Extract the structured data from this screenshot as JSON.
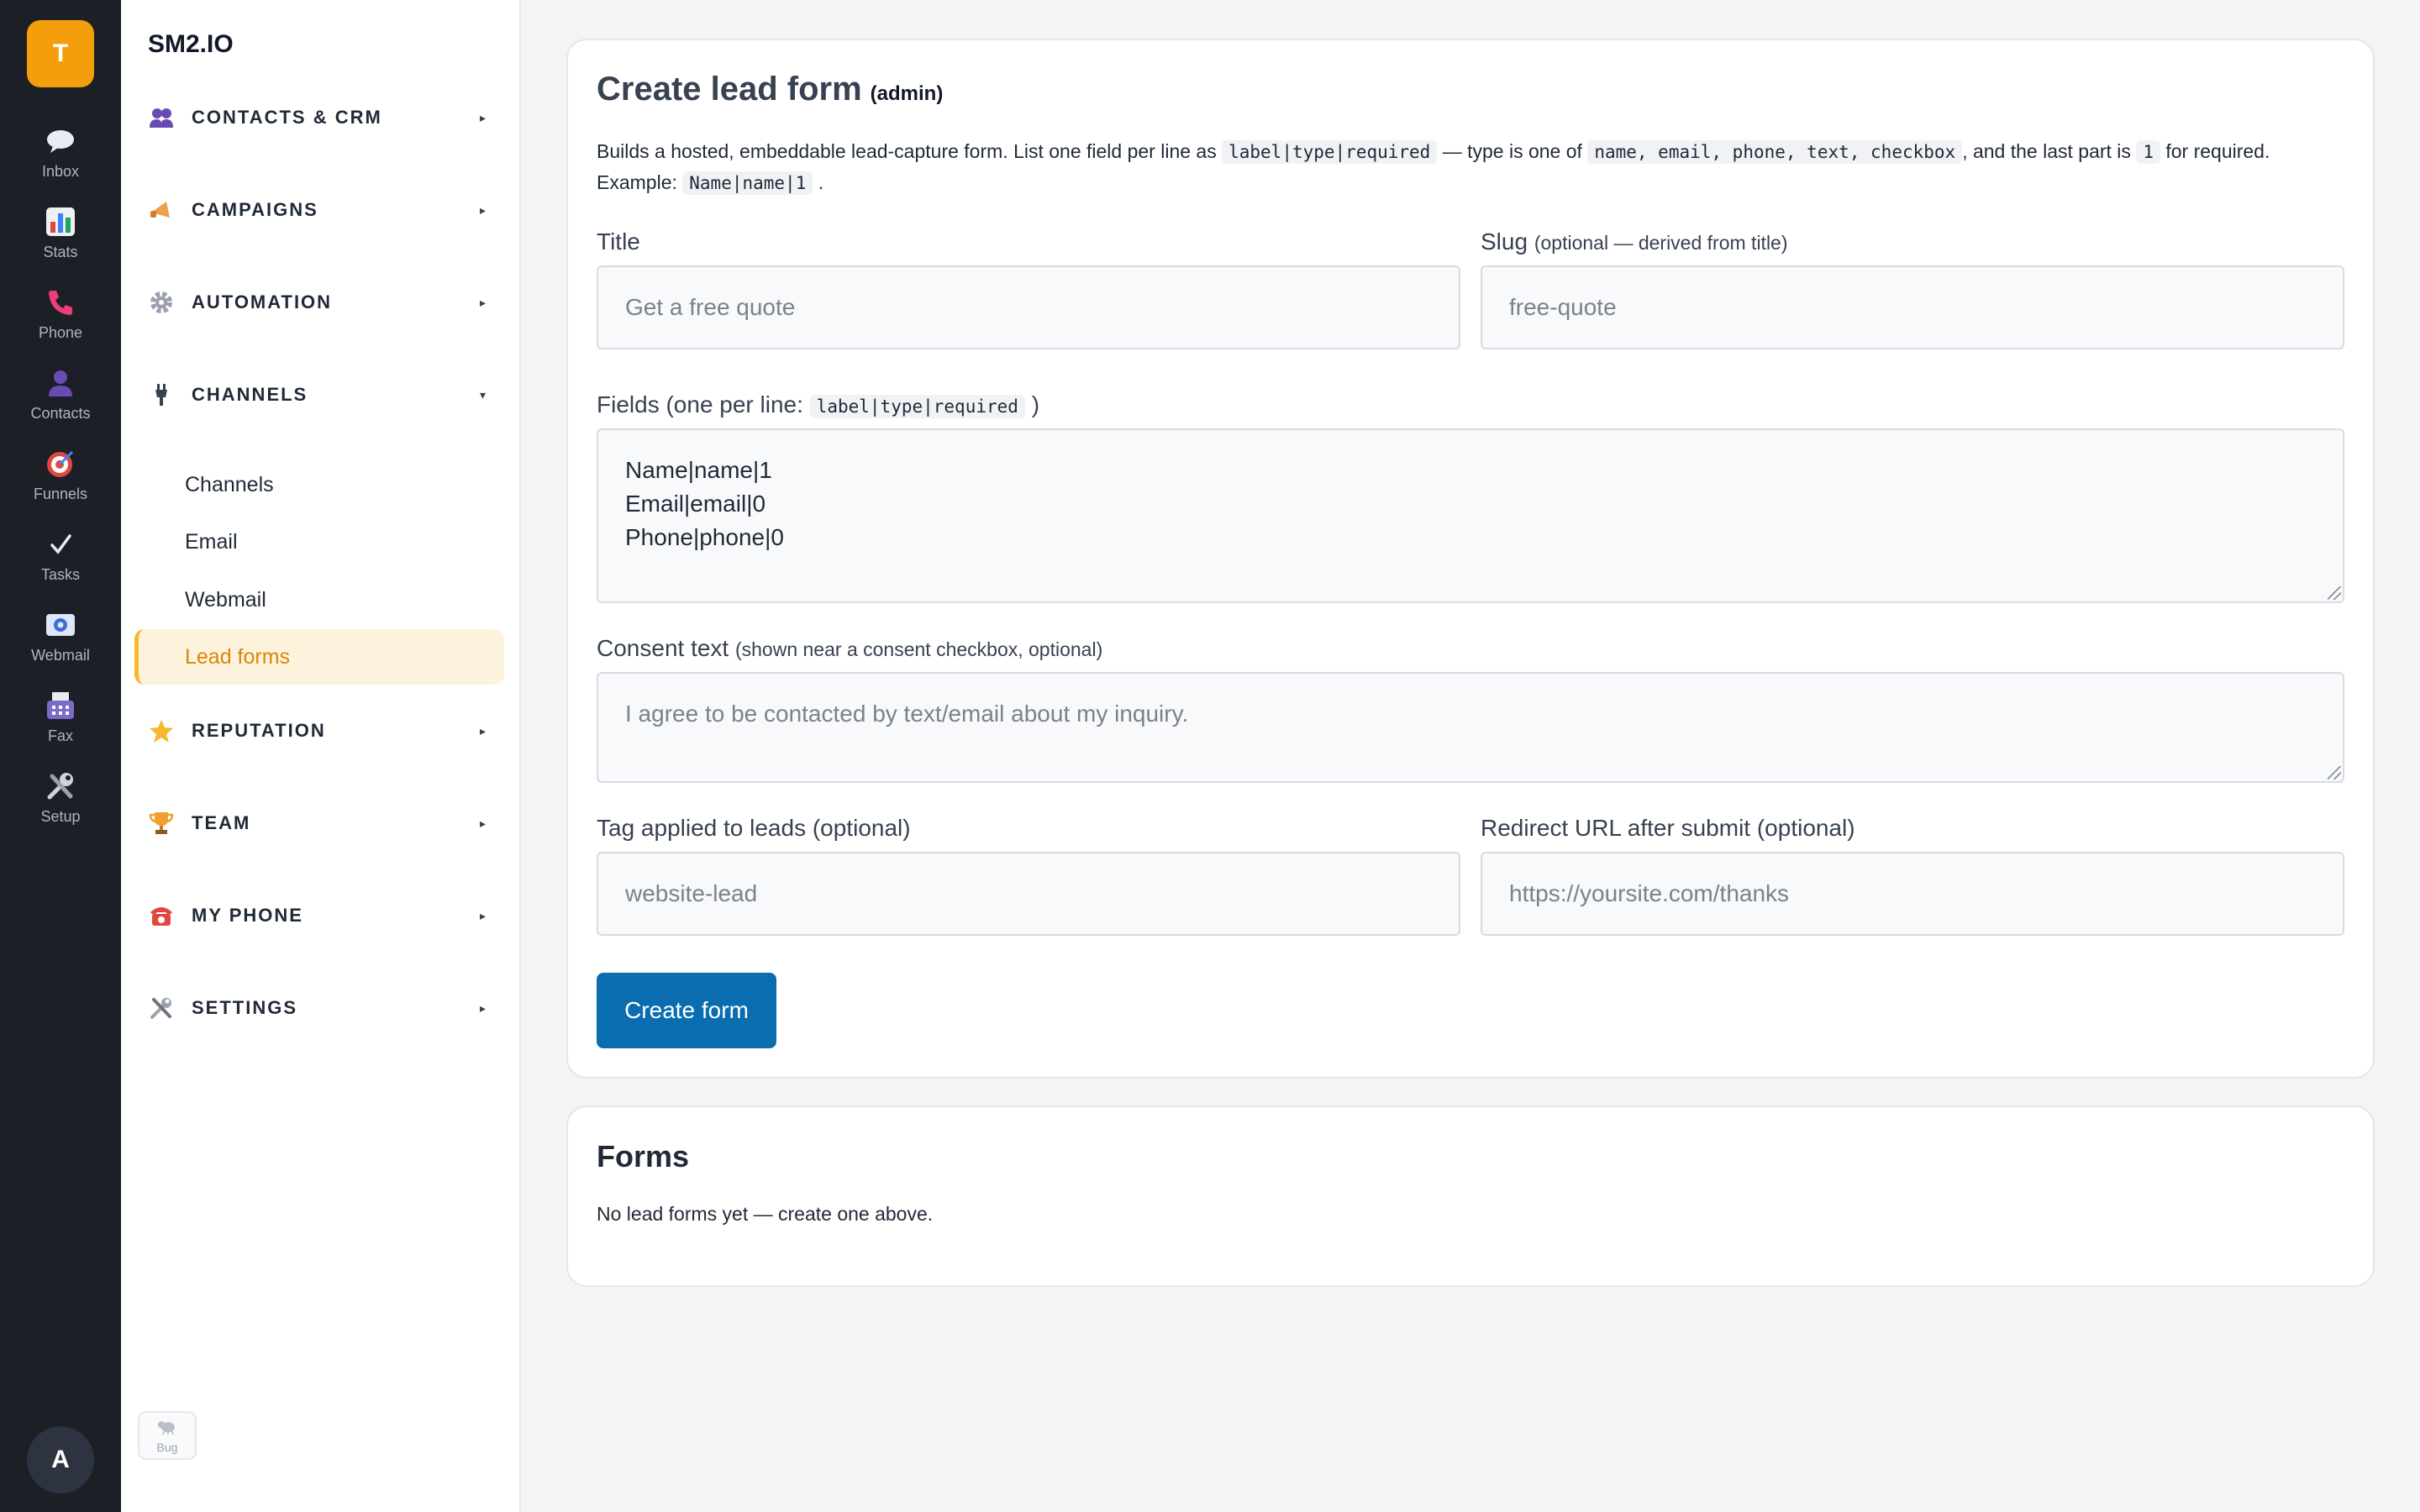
{
  "rail": {
    "brand_initial": "T",
    "items": [
      {
        "label": "Inbox",
        "icon": "chat-bubble-icon"
      },
      {
        "label": "Stats",
        "icon": "bar-chart-icon"
      },
      {
        "label": "Phone",
        "icon": "phone-icon"
      },
      {
        "label": "Contacts",
        "icon": "person-icon"
      },
      {
        "label": "Funnels",
        "icon": "target-icon"
      },
      {
        "label": "Tasks",
        "icon": "checkmark-icon"
      },
      {
        "label": "Webmail",
        "icon": "mail-icon"
      },
      {
        "label": "Fax",
        "icon": "fax-icon"
      },
      {
        "label": "Setup",
        "icon": "tools-icon"
      }
    ],
    "user_initial": "A"
  },
  "sidebar": {
    "brand": "SM2.IO",
    "groups": [
      {
        "label": "CONTACTS & CRM",
        "icon": "people-icon",
        "caret": "▸"
      },
      {
        "label": "CAMPAIGNS",
        "icon": "megaphone-icon",
        "caret": "▸"
      },
      {
        "label": "AUTOMATION",
        "icon": "gear-icon",
        "caret": "▸"
      },
      {
        "label": "CHANNELS",
        "icon": "plug-icon",
        "caret": "▾"
      },
      {
        "label": "REPUTATION",
        "icon": "star-icon",
        "caret": "▸"
      },
      {
        "label": "TEAM",
        "icon": "trophy-icon",
        "caret": "▸"
      },
      {
        "label": "MY PHONE",
        "icon": "telephone-icon",
        "caret": "▸"
      },
      {
        "label": "SETTINGS",
        "icon": "tools-icon",
        "caret": "▸"
      }
    ],
    "channels_items": [
      "Channels",
      "Email",
      "Webmail",
      "Lead forms"
    ],
    "active_item": "Lead forms",
    "bug_label": "Bug"
  },
  "create_form": {
    "title": "Create lead form",
    "title_sub": "(admin)",
    "desc": {
      "p1": "Builds a hosted, embeddable lead-capture form. List one field per line as",
      "c1": "label|type|required",
      "p2": "— type is one of",
      "c2": "name, email, phone, text, checkbox",
      "p3": ", and the last part is",
      "c3": "1",
      "p4": "for required. Example:",
      "c4": "Name|name|1",
      "p5": "."
    },
    "title_field": {
      "label": "Title",
      "placeholder": "Get a free quote"
    },
    "slug_field": {
      "label": "Slug",
      "hint": "(optional — derived from title)",
      "placeholder": "free-quote"
    },
    "fields_field": {
      "label": "Fields (one per line:",
      "label_code": "label|type|required",
      "label_end": ")",
      "value": "Name|name|1\nEmail|email|0\nPhone|phone|0"
    },
    "consent_field": {
      "label": "Consent text",
      "hint": "(shown near a consent checkbox, optional)",
      "placeholder": "I agree to be contacted by text/email about my inquiry."
    },
    "tag_field": {
      "label": "Tag applied to leads (optional)",
      "placeholder": "website-lead"
    },
    "redirect_field": {
      "label": "Redirect URL after submit (optional)",
      "placeholder": "https://yoursite.com/thanks"
    },
    "submit_label": "Create form"
  },
  "forms_list": {
    "title": "Forms",
    "empty_text": "No lead forms yet — create one above."
  },
  "colors": {
    "rail_bg": "#1c1f26",
    "brand_accent": "#f59e0b",
    "active_bg": "#fdf3dd",
    "active_text": "#d9860b",
    "primary_button": "#0a6db0"
  }
}
